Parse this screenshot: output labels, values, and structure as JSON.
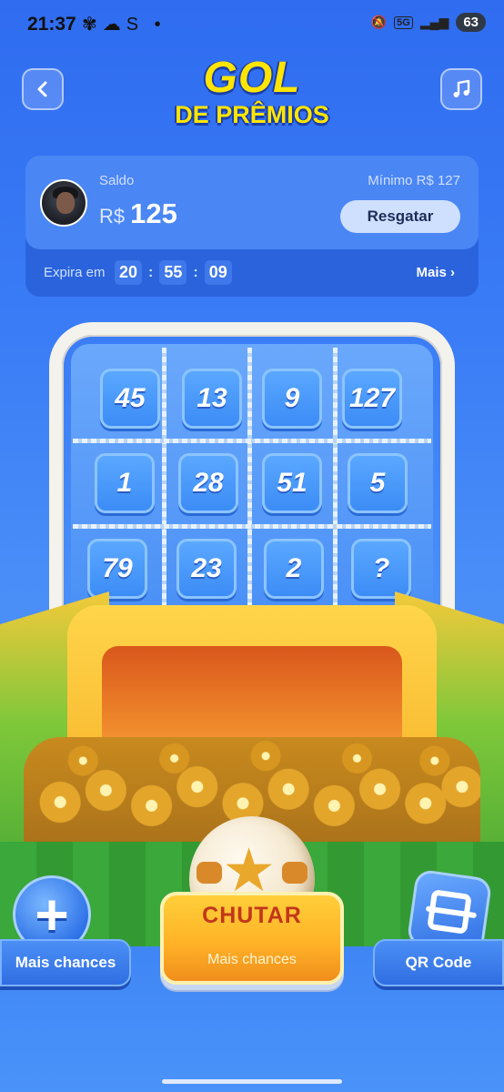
{
  "status_bar": {
    "time": "21:37",
    "left_icons": "✾☁S •",
    "network": "5G",
    "battery": "63"
  },
  "header": {
    "title_line1": "GOL",
    "title_line2": "DE PRÊMIOS"
  },
  "balance": {
    "label": "Saldo",
    "currency": "R$",
    "amount": "125",
    "minimum_label": "Mínimo  R$ 127",
    "redeem_label": "Resgatar",
    "expires_label": "Expira em",
    "timer": {
      "hours": "20",
      "minutes": "55",
      "seconds": "09"
    },
    "more_label": "Mais ›"
  },
  "grid": {
    "tiles": [
      "45",
      "13",
      "9",
      "127",
      "1",
      "28",
      "51",
      "5",
      "79",
      "23",
      "2",
      "?"
    ]
  },
  "actions": {
    "left_label": "Mais chances",
    "kick_label": "CHUTAR",
    "kick_sub": "Mais chances",
    "right_label": "QR Code"
  },
  "colors": {
    "accent_yellow": "#ffe500",
    "primary_blue": "#3a7cf6",
    "kick_orange": "#ffb327"
  }
}
